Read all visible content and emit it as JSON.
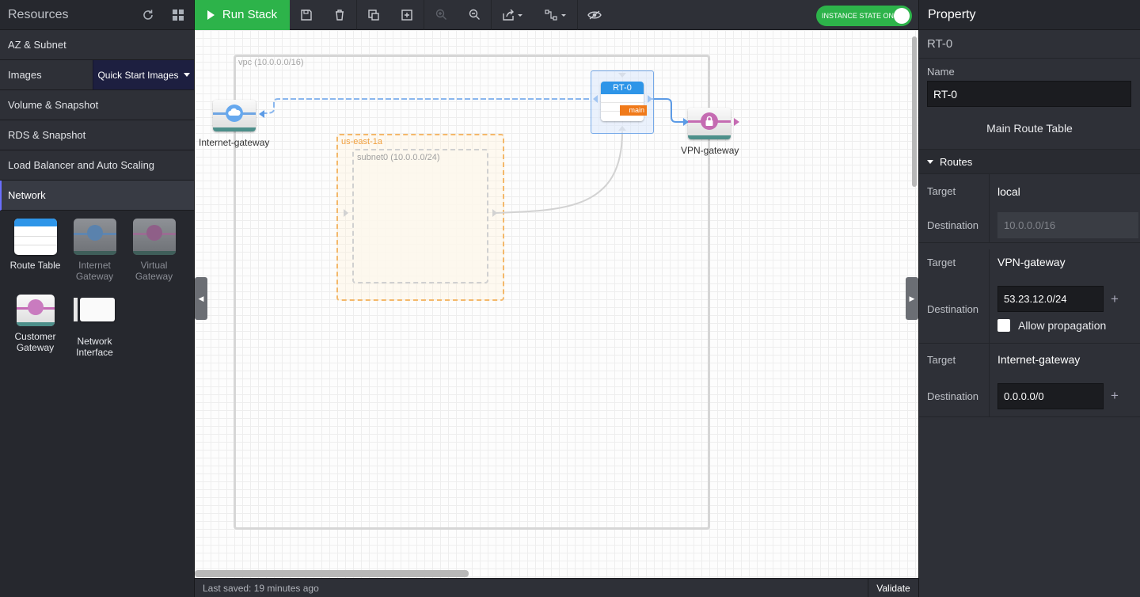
{
  "sidebar": {
    "title": "Resources",
    "sections": [
      {
        "label": "AZ & Subnet"
      },
      {
        "label": "Images"
      },
      {
        "label": "Volume & Snapshot"
      },
      {
        "label": "RDS & Snapshot"
      },
      {
        "label": "Load Balancer and Auto Scaling"
      },
      {
        "label": "Network"
      }
    ],
    "quick_start": "Quick Start Images",
    "palette": [
      {
        "label": "Route Table",
        "icon": "route-table-icon"
      },
      {
        "label": "Internet Gateway",
        "icon": "internet-gateway-icon"
      },
      {
        "label": "Virtual Gateway",
        "icon": "virtual-gateway-icon"
      },
      {
        "label": "Customer Gateway",
        "icon": "customer-gateway-icon"
      },
      {
        "label": "Network Interface",
        "icon": "network-interface-icon"
      }
    ]
  },
  "toolbar": {
    "run_label": "Run Stack",
    "instance_state": "INSTANCE STATE ON",
    "run_color": "#2db34a"
  },
  "canvas": {
    "vpc_label": "vpc (10.0.0.0/16)",
    "az_label": "us-east-1a",
    "subnet_label": "subnet0 (10.0.0.0/24)",
    "igw_label": "Internet-gateway",
    "vgw_label": "VPN-gateway",
    "rt_label": "RT-0",
    "rt_tag": "main"
  },
  "status": {
    "saved": "Last saved: 19 minutes ago",
    "validate": "Validate"
  },
  "panel": {
    "title": "Property",
    "resource": "RT-0",
    "name_label": "Name",
    "name_value": "RT-0",
    "main_route_table": "Main Route Table",
    "routes_label": "Routes",
    "target_label": "Target",
    "destination_label": "Destination",
    "routes": [
      {
        "target": "local",
        "destination": "10.0.0.0/16"
      },
      {
        "target": "VPN-gateway",
        "destination": "53.23.12.0/24",
        "propagation": "Allow propagation"
      },
      {
        "target": "Internet-gateway",
        "destination": "0.0.0.0/0"
      }
    ]
  }
}
